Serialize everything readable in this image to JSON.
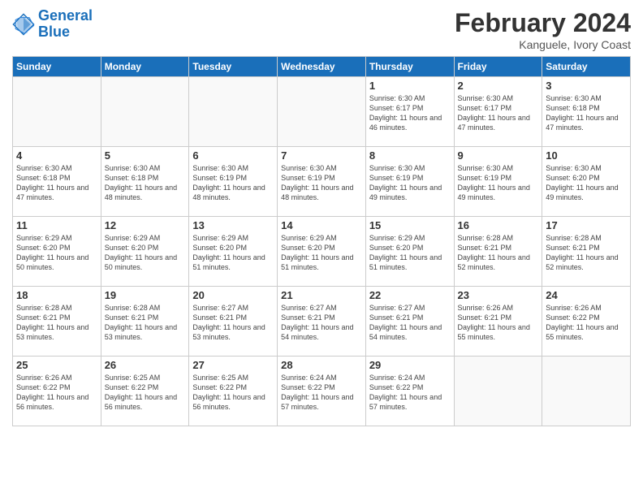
{
  "logo": {
    "line1": "General",
    "line2": "Blue"
  },
  "title": "February 2024",
  "subtitle": "Kanguele, Ivory Coast",
  "days_of_week": [
    "Sunday",
    "Monday",
    "Tuesday",
    "Wednesday",
    "Thursday",
    "Friday",
    "Saturday"
  ],
  "weeks": [
    [
      {
        "day": "",
        "info": ""
      },
      {
        "day": "",
        "info": ""
      },
      {
        "day": "",
        "info": ""
      },
      {
        "day": "",
        "info": ""
      },
      {
        "day": "1",
        "info": "Sunrise: 6:30 AM\nSunset: 6:17 PM\nDaylight: 11 hours\nand 46 minutes."
      },
      {
        "day": "2",
        "info": "Sunrise: 6:30 AM\nSunset: 6:17 PM\nDaylight: 11 hours\nand 47 minutes."
      },
      {
        "day": "3",
        "info": "Sunrise: 6:30 AM\nSunset: 6:18 PM\nDaylight: 11 hours\nand 47 minutes."
      }
    ],
    [
      {
        "day": "4",
        "info": "Sunrise: 6:30 AM\nSunset: 6:18 PM\nDaylight: 11 hours\nand 47 minutes."
      },
      {
        "day": "5",
        "info": "Sunrise: 6:30 AM\nSunset: 6:18 PM\nDaylight: 11 hours\nand 48 minutes."
      },
      {
        "day": "6",
        "info": "Sunrise: 6:30 AM\nSunset: 6:19 PM\nDaylight: 11 hours\nand 48 minutes."
      },
      {
        "day": "7",
        "info": "Sunrise: 6:30 AM\nSunset: 6:19 PM\nDaylight: 11 hours\nand 48 minutes."
      },
      {
        "day": "8",
        "info": "Sunrise: 6:30 AM\nSunset: 6:19 PM\nDaylight: 11 hours\nand 49 minutes."
      },
      {
        "day": "9",
        "info": "Sunrise: 6:30 AM\nSunset: 6:19 PM\nDaylight: 11 hours\nand 49 minutes."
      },
      {
        "day": "10",
        "info": "Sunrise: 6:30 AM\nSunset: 6:20 PM\nDaylight: 11 hours\nand 49 minutes."
      }
    ],
    [
      {
        "day": "11",
        "info": "Sunrise: 6:29 AM\nSunset: 6:20 PM\nDaylight: 11 hours\nand 50 minutes."
      },
      {
        "day": "12",
        "info": "Sunrise: 6:29 AM\nSunset: 6:20 PM\nDaylight: 11 hours\nand 50 minutes."
      },
      {
        "day": "13",
        "info": "Sunrise: 6:29 AM\nSunset: 6:20 PM\nDaylight: 11 hours\nand 51 minutes."
      },
      {
        "day": "14",
        "info": "Sunrise: 6:29 AM\nSunset: 6:20 PM\nDaylight: 11 hours\nand 51 minutes."
      },
      {
        "day": "15",
        "info": "Sunrise: 6:29 AM\nSunset: 6:20 PM\nDaylight: 11 hours\nand 51 minutes."
      },
      {
        "day": "16",
        "info": "Sunrise: 6:28 AM\nSunset: 6:21 PM\nDaylight: 11 hours\nand 52 minutes."
      },
      {
        "day": "17",
        "info": "Sunrise: 6:28 AM\nSunset: 6:21 PM\nDaylight: 11 hours\nand 52 minutes."
      }
    ],
    [
      {
        "day": "18",
        "info": "Sunrise: 6:28 AM\nSunset: 6:21 PM\nDaylight: 11 hours\nand 53 minutes."
      },
      {
        "day": "19",
        "info": "Sunrise: 6:28 AM\nSunset: 6:21 PM\nDaylight: 11 hours\nand 53 minutes."
      },
      {
        "day": "20",
        "info": "Sunrise: 6:27 AM\nSunset: 6:21 PM\nDaylight: 11 hours\nand 53 minutes."
      },
      {
        "day": "21",
        "info": "Sunrise: 6:27 AM\nSunset: 6:21 PM\nDaylight: 11 hours\nand 54 minutes."
      },
      {
        "day": "22",
        "info": "Sunrise: 6:27 AM\nSunset: 6:21 PM\nDaylight: 11 hours\nand 54 minutes."
      },
      {
        "day": "23",
        "info": "Sunrise: 6:26 AM\nSunset: 6:21 PM\nDaylight: 11 hours\nand 55 minutes."
      },
      {
        "day": "24",
        "info": "Sunrise: 6:26 AM\nSunset: 6:22 PM\nDaylight: 11 hours\nand 55 minutes."
      }
    ],
    [
      {
        "day": "25",
        "info": "Sunrise: 6:26 AM\nSunset: 6:22 PM\nDaylight: 11 hours\nand 56 minutes."
      },
      {
        "day": "26",
        "info": "Sunrise: 6:25 AM\nSunset: 6:22 PM\nDaylight: 11 hours\nand 56 minutes."
      },
      {
        "day": "27",
        "info": "Sunrise: 6:25 AM\nSunset: 6:22 PM\nDaylight: 11 hours\nand 56 minutes."
      },
      {
        "day": "28",
        "info": "Sunrise: 6:24 AM\nSunset: 6:22 PM\nDaylight: 11 hours\nand 57 minutes."
      },
      {
        "day": "29",
        "info": "Sunrise: 6:24 AM\nSunset: 6:22 PM\nDaylight: 11 hours\nand 57 minutes."
      },
      {
        "day": "",
        "info": ""
      },
      {
        "day": "",
        "info": ""
      }
    ]
  ]
}
